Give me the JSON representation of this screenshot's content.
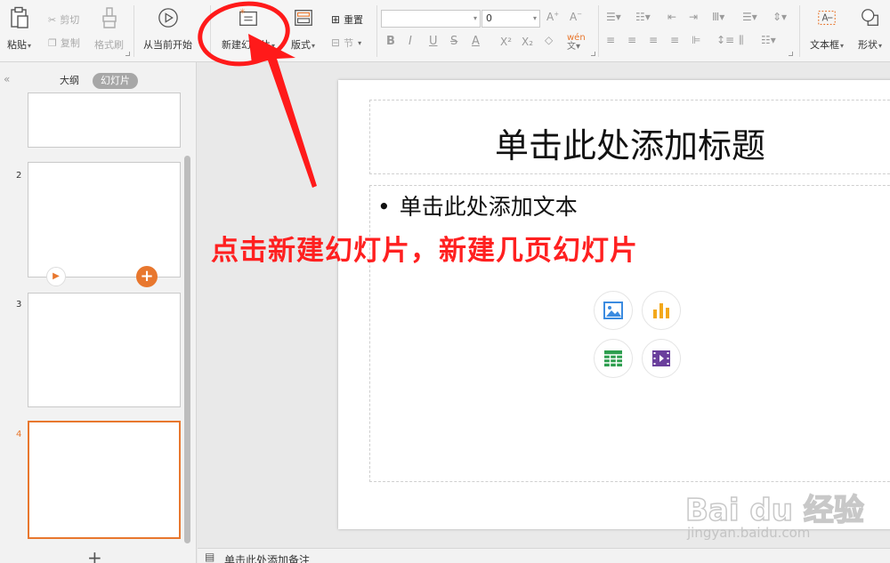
{
  "ribbon": {
    "paste": "粘贴",
    "cut": "剪切",
    "copy": "复制",
    "format_painter": "格式刷",
    "start_from_current": "从当前开始",
    "new_slide": "新建幻灯片",
    "layout": "版式",
    "reset": "重置",
    "section": "节",
    "font_size": "0",
    "text_box": "文本框",
    "shape": "形状"
  },
  "left_panel": {
    "tab_outline": "大纲",
    "tab_slides": "幻灯片",
    "thumbnails": [
      {
        "num": ""
      },
      {
        "num": "2"
      },
      {
        "num": "3"
      },
      {
        "num": "4"
      }
    ],
    "add": "+"
  },
  "slide": {
    "title_placeholder": "单击此处添加标题",
    "body_bullet": "•",
    "body_placeholder": "单击此处添加文本"
  },
  "notes": {
    "placeholder": "单击此处添加备注"
  },
  "annotation": {
    "text": "点击新建幻灯片，新建几页幻灯片"
  },
  "watermark": {
    "logo": "Bai du 经验",
    "url": "jingyan.baidu.com"
  },
  "colors": {
    "accent": "#e8772e",
    "annotation": "#ff1a1a"
  }
}
